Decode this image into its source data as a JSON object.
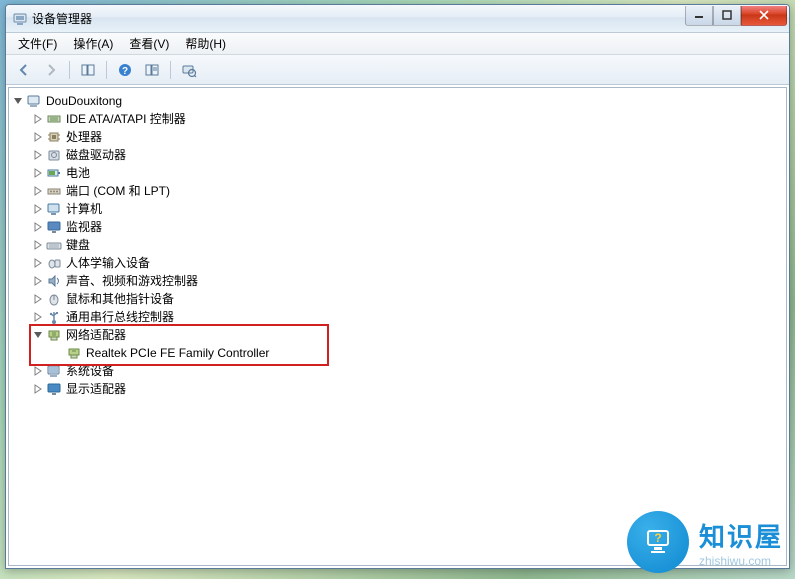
{
  "window": {
    "title": "设备管理器"
  },
  "menu": {
    "file": "文件(F)",
    "action": "操作(A)",
    "view": "查看(V)",
    "help": "帮助(H)"
  },
  "toolbar": {
    "back": "back",
    "forward": "forward",
    "up": "show-hidden",
    "help": "help",
    "properties": "properties",
    "scan": "scan-hardware"
  },
  "tree": {
    "root": {
      "label": "DouDouxitong"
    },
    "categories": [
      {
        "label": "IDE ATA/ATAPI 控制器",
        "iconName": "controller-icon"
      },
      {
        "label": "处理器",
        "iconName": "cpu-icon"
      },
      {
        "label": "磁盘驱动器",
        "iconName": "disk-icon"
      },
      {
        "label": "电池",
        "iconName": "battery-icon"
      },
      {
        "label": "端口 (COM 和 LPT)",
        "iconName": "port-icon"
      },
      {
        "label": "计算机",
        "iconName": "computer-icon"
      },
      {
        "label": "监视器",
        "iconName": "monitor-icon"
      },
      {
        "label": "键盘",
        "iconName": "keyboard-icon"
      },
      {
        "label": "人体学输入设备",
        "iconName": "hid-icon"
      },
      {
        "label": "声音、视频和游戏控制器",
        "iconName": "sound-icon"
      },
      {
        "label": "鼠标和其他指针设备",
        "iconName": "mouse-icon"
      },
      {
        "label": "通用串行总线控制器",
        "iconName": "usb-icon"
      },
      {
        "label": "网络适配器",
        "iconName": "network-icon",
        "expanded": true,
        "children": [
          {
            "label": "Realtek PCIe FE Family Controller",
            "iconName": "nic-device-icon"
          }
        ]
      },
      {
        "label": "系统设备",
        "iconName": "system-icon"
      },
      {
        "label": "显示适配器",
        "iconName": "display-icon"
      }
    ]
  },
  "watermark": {
    "brand": "知识屋",
    "domain": "zhishiwu.com"
  }
}
